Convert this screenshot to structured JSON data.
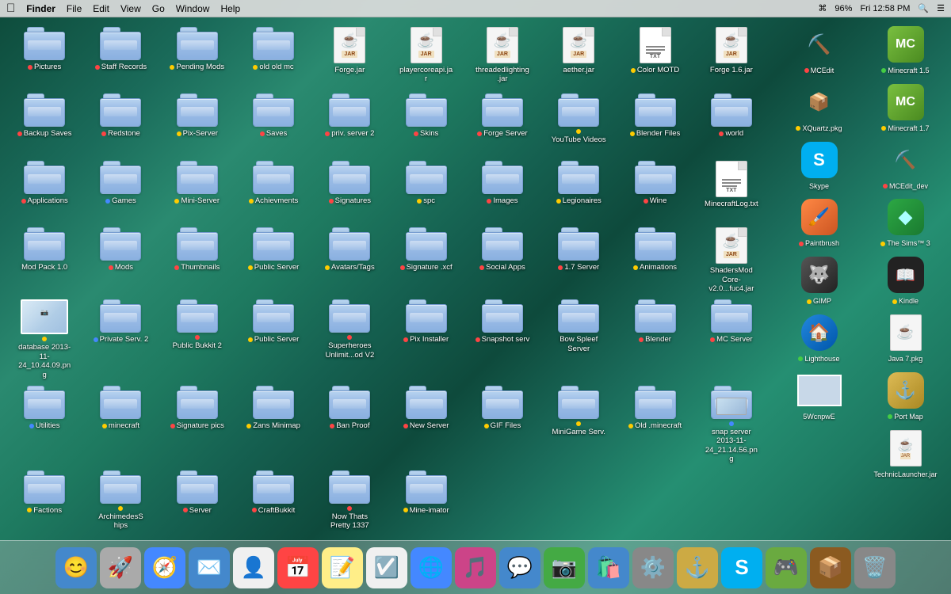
{
  "menubar": {
    "apple": "🍎",
    "items": [
      "Finder",
      "File",
      "Edit",
      "View",
      "Go",
      "Window",
      "Help"
    ],
    "right_items": [
      "96%",
      "Fri 12:58 PM"
    ],
    "battery": "96%",
    "time": "Fri 12:58 PM"
  },
  "desktop_items": [
    {
      "id": "pictures",
      "label": "Pictures",
      "dot": "red",
      "type": "folder",
      "row": 1,
      "col": 1
    },
    {
      "id": "staff-records",
      "label": "Staff Records",
      "dot": "red",
      "type": "folder",
      "row": 1,
      "col": 2
    },
    {
      "id": "pending-mods",
      "label": "Pending Mods",
      "dot": "yellow",
      "type": "folder",
      "row": 1,
      "col": 3
    },
    {
      "id": "old-old-mc",
      "label": "old old mc",
      "dot": "yellow",
      "type": "folder",
      "row": 1,
      "col": 4
    },
    {
      "id": "forge-jar",
      "label": "Forge.jar",
      "dot": "none",
      "type": "jar",
      "row": 1,
      "col": 5
    },
    {
      "id": "playercoreapi-jar",
      "label": "playercoreapi.jar",
      "dot": "none",
      "type": "jar",
      "row": 1,
      "col": 6
    },
    {
      "id": "threadedlighting-jar",
      "label": "threadedlighting.jar",
      "dot": "none",
      "type": "jar",
      "row": 1,
      "col": 7
    },
    {
      "id": "aether-jar",
      "label": "aether.jar",
      "dot": "none",
      "type": "jar",
      "row": 1,
      "col": 8
    },
    {
      "id": "color-motd",
      "label": "Color MOTD",
      "dot": "yellow",
      "type": "txt",
      "row": 1,
      "col": 9
    },
    {
      "id": "forge16-jar",
      "label": "Forge 1.6.jar",
      "dot": "none",
      "type": "jar",
      "row": 1,
      "col": 10
    },
    {
      "id": "backup-saves",
      "label": "Backup Saves",
      "dot": "red",
      "type": "folder",
      "row": 2,
      "col": 1
    },
    {
      "id": "redstone",
      "label": "Redstone",
      "dot": "red",
      "type": "folder",
      "row": 2,
      "col": 2
    },
    {
      "id": "pix-server",
      "label": "Pix-Server",
      "dot": "yellow",
      "type": "folder",
      "row": 2,
      "col": 3
    },
    {
      "id": "saves",
      "label": "Saves",
      "dot": "red",
      "type": "folder",
      "row": 2,
      "col": 4
    },
    {
      "id": "priv-server-2",
      "label": "priv. server 2",
      "dot": "red",
      "type": "folder",
      "row": 2,
      "col": 5
    },
    {
      "id": "skins",
      "label": "Skins",
      "dot": "red",
      "type": "folder",
      "row": 2,
      "col": 6
    },
    {
      "id": "forge-server",
      "label": "Forge Server",
      "dot": "red",
      "type": "folder",
      "row": 2,
      "col": 7
    },
    {
      "id": "youtube-videos",
      "label": "YouTube Videos",
      "dot": "yellow",
      "type": "folder",
      "row": 2,
      "col": 8
    },
    {
      "id": "blender-files",
      "label": "Blender Files",
      "dot": "yellow",
      "type": "folder",
      "row": 2,
      "col": 9
    },
    {
      "id": "world",
      "label": "world",
      "dot": "red",
      "type": "folder",
      "row": 2,
      "col": 10
    },
    {
      "id": "applications",
      "label": "Applications",
      "dot": "red",
      "type": "folder",
      "row": 3,
      "col": 1
    },
    {
      "id": "games",
      "label": "Games",
      "dot": "blue",
      "type": "folder",
      "row": 3,
      "col": 2
    },
    {
      "id": "mini-server",
      "label": "Mini-Server",
      "dot": "yellow",
      "type": "folder",
      "row": 3,
      "col": 3
    },
    {
      "id": "achievments",
      "label": "Achievments",
      "dot": "yellow",
      "type": "folder",
      "row": 3,
      "col": 4
    },
    {
      "id": "signatures",
      "label": "Signatures",
      "dot": "red",
      "type": "folder",
      "row": 3,
      "col": 5
    },
    {
      "id": "spc",
      "label": "spc",
      "dot": "yellow",
      "type": "folder",
      "row": 3,
      "col": 6
    },
    {
      "id": "images",
      "label": "Images",
      "dot": "red",
      "type": "folder",
      "row": 3,
      "col": 7
    },
    {
      "id": "legionaires",
      "label": "Legionaires",
      "dot": "yellow",
      "type": "folder",
      "row": 3,
      "col": 8
    },
    {
      "id": "wine",
      "label": "Wine",
      "dot": "red",
      "type": "folder",
      "row": 3,
      "col": 9
    },
    {
      "id": "minecraftlog-txt",
      "label": "MinecraftLog.txt",
      "dot": "none",
      "type": "txt",
      "row": 3,
      "col": 10
    },
    {
      "id": "mod-pack",
      "label": "Mod Pack 1.0",
      "dot": "none",
      "type": "folder",
      "row": 4,
      "col": 1
    },
    {
      "id": "mods",
      "label": "Mods",
      "dot": "red",
      "type": "folder",
      "row": 4,
      "col": 2
    },
    {
      "id": "thumbnails",
      "label": "Thumbnails",
      "dot": "red",
      "type": "folder",
      "row": 4,
      "col": 3
    },
    {
      "id": "public-server",
      "label": "Public Server",
      "dot": "yellow",
      "type": "folder",
      "row": 4,
      "col": 4
    },
    {
      "id": "avatars-tags",
      "label": "Avatars/Tags",
      "dot": "yellow",
      "type": "folder",
      "row": 4,
      "col": 5
    },
    {
      "id": "signature-xcf",
      "label": "Signature .xcf",
      "dot": "red",
      "type": "folder",
      "row": 4,
      "col": 6
    },
    {
      "id": "social-apps",
      "label": "Social Apps",
      "dot": "red",
      "type": "folder",
      "row": 4,
      "col": 7
    },
    {
      "id": "17-server",
      "label": "1.7 Server",
      "dot": "red",
      "type": "folder",
      "row": 4,
      "col": 8
    },
    {
      "id": "animations",
      "label": "Animations",
      "dot": "yellow",
      "type": "folder",
      "row": 4,
      "col": 9
    },
    {
      "id": "shadersmod-jar",
      "label": "ShadersMod Core-v2.0...fuc4.jar",
      "dot": "none",
      "type": "jar",
      "row": 4,
      "col": 10
    },
    {
      "id": "database-png",
      "label": "database 2013-11-24_10.44.09.png",
      "dot": "yellow",
      "type": "image",
      "row": 5,
      "col": 1
    },
    {
      "id": "private-serv",
      "label": "Private Serv. 2",
      "dot": "blue",
      "type": "folder",
      "row": 5,
      "col": 2
    },
    {
      "id": "public-bukkit",
      "label": "Public Bukkit 2",
      "dot": "red",
      "type": "folder",
      "row": 5,
      "col": 3
    },
    {
      "id": "public-server2",
      "label": "Public Server",
      "dot": "yellow",
      "type": "folder",
      "row": 5,
      "col": 4
    },
    {
      "id": "superheroes-unlim",
      "label": "Superheroes Unlimit...od V2",
      "dot": "red",
      "type": "folder",
      "row": 5,
      "col": 5
    },
    {
      "id": "pix-installer",
      "label": "Pix Installer",
      "dot": "red",
      "type": "folder",
      "row": 5,
      "col": 6
    },
    {
      "id": "snapshot-serv",
      "label": "Snapshot serv",
      "dot": "red",
      "type": "folder",
      "row": 5,
      "col": 7
    },
    {
      "id": "bow-spleef-server",
      "label": "Bow Spleef Server",
      "dot": "none",
      "type": "folder",
      "row": 5,
      "col": 8
    },
    {
      "id": "blender-app",
      "label": "Blender",
      "dot": "red",
      "type": "folder",
      "row": 5,
      "col": 9
    },
    {
      "id": "mc-server",
      "label": "MC Server",
      "dot": "red",
      "type": "folder",
      "row": 6,
      "col": 1
    },
    {
      "id": "utilities",
      "label": "Utilities",
      "dot": "blue",
      "type": "folder",
      "row": 6,
      "col": 2
    },
    {
      "id": "minecraft-folder",
      "label": "minecraft",
      "dot": "yellow",
      "type": "folder",
      "row": 6,
      "col": 3
    },
    {
      "id": "signature-pics",
      "label": "Signature pics",
      "dot": "red",
      "type": "folder",
      "row": 6,
      "col": 4
    },
    {
      "id": "zans-minimap",
      "label": "Zans Minimap",
      "dot": "yellow",
      "type": "folder",
      "row": 6,
      "col": 5
    },
    {
      "id": "ban-proof",
      "label": "Ban Proof",
      "dot": "red",
      "type": "folder",
      "row": 6,
      "col": 6
    },
    {
      "id": "new-server",
      "label": "New Server",
      "dot": "red",
      "type": "folder",
      "row": 6,
      "col": 7
    },
    {
      "id": "gif-files",
      "label": "GIF Files",
      "dot": "yellow",
      "type": "folder",
      "row": 6,
      "col": 8
    },
    {
      "id": "minigame-serv",
      "label": "MiniGame Serv.",
      "dot": "yellow",
      "type": "folder",
      "row": 6,
      "col": 9
    },
    {
      "id": "old-minecraft",
      "label": "Old .minecraft",
      "dot": "yellow",
      "type": "folder",
      "row": 7,
      "col": 1
    },
    {
      "id": "snap-server",
      "label": "snap server 2013-11-24_21.14.56.png",
      "dot": "blue",
      "type": "folder_img",
      "row": 7,
      "col": 2
    },
    {
      "id": "factions",
      "label": "Factions",
      "dot": "yellow",
      "type": "folder",
      "row": 7,
      "col": 3
    },
    {
      "id": "archimedes-ships",
      "label": "ArchimedesS hips",
      "dot": "yellow",
      "type": "folder",
      "row": 7,
      "col": 4
    },
    {
      "id": "server",
      "label": "Server",
      "dot": "red",
      "type": "folder",
      "row": 7,
      "col": 5
    },
    {
      "id": "craftbukkit",
      "label": "CraftBukkit",
      "dot": "red",
      "type": "folder",
      "row": 7,
      "col": 6
    },
    {
      "id": "now-thats-pretty",
      "label": "Now Thats Pretty 1337",
      "dot": "red",
      "type": "folder",
      "row": 7,
      "col": 7
    },
    {
      "id": "mine-imator",
      "label": "Mine-imator",
      "dot": "yellow",
      "type": "folder",
      "row": 7,
      "col": 8
    }
  ],
  "right_apps": [
    {
      "id": "mcedit",
      "label": "MCEdit",
      "dot": "red",
      "color": "#4a8a4a",
      "emoji": "⛏️"
    },
    {
      "id": "minecraft15",
      "label": "Minecraft 1.5",
      "dot": "green",
      "color": "#5a9a3a",
      "emoji": "🎮"
    },
    {
      "id": "xquartz-pkg",
      "label": "XQuartz.pkg",
      "dot": "yellow",
      "color": "#888",
      "emoji": "📦"
    },
    {
      "id": "minecraft17",
      "label": "Minecraft 1.7",
      "dot": "yellow",
      "color": "#6aaa40",
      "emoji": "🎮"
    },
    {
      "id": "skype",
      "label": "Skype",
      "dot": "none",
      "color": "#00aff0",
      "emoji": "S"
    },
    {
      "id": "mcedit-dev",
      "label": "MCEdit_dev",
      "dot": "red",
      "color": "#4a8a4a",
      "emoji": "⛏️"
    },
    {
      "id": "paintbrush",
      "label": "Paintbrush",
      "dot": "red",
      "color": "#cc6622",
      "emoji": "🖌️"
    },
    {
      "id": "sims3",
      "label": "The Sims™ 3",
      "dot": "yellow",
      "color": "#2ca844",
      "emoji": "💎"
    },
    {
      "id": "gimp",
      "label": "GIMP",
      "dot": "yellow",
      "color": "#333",
      "emoji": "🐺"
    },
    {
      "id": "kindle",
      "label": "Kindle",
      "dot": "yellow",
      "color": "#ff9900",
      "emoji": "📖"
    },
    {
      "id": "lighthouse",
      "label": "Lighthouse",
      "dot": "green",
      "color": "#1177cc",
      "emoji": "🏠"
    },
    {
      "id": "java7-pkg",
      "label": "Java 7.pkg",
      "dot": "none",
      "color": "#888",
      "emoji": "☕"
    },
    {
      "id": "5wcnpwe",
      "label": "5WcnpwE",
      "dot": "none",
      "color": "#888",
      "emoji": "🖼️"
    },
    {
      "id": "port-map",
      "label": "Port Map",
      "dot": "green",
      "color": "#ccaa44",
      "emoji": "⚓"
    },
    {
      "id": "technic-launcher",
      "label": "TechnicLauncher.jar",
      "dot": "none",
      "color": "#555",
      "emoji": "☕"
    }
  ],
  "dock_items": [
    {
      "id": "finder",
      "emoji": "😊",
      "color": "#4488cc",
      "label": "Finder"
    },
    {
      "id": "launchpad",
      "emoji": "🚀",
      "color": "#cccccc",
      "label": "Launchpad"
    },
    {
      "id": "safari",
      "emoji": "🧭",
      "color": "#4488ff",
      "label": "Safari"
    },
    {
      "id": "mail",
      "emoji": "✉️",
      "color": "#4488cc",
      "label": "Mail"
    },
    {
      "id": "contacts",
      "emoji": "👤",
      "color": "#f5f5f5",
      "label": "Contacts"
    },
    {
      "id": "calendar",
      "emoji": "📅",
      "color": "#ff4444",
      "label": "Calendar"
    },
    {
      "id": "notes",
      "emoji": "📝",
      "color": "#ffee88",
      "label": "Notes"
    },
    {
      "id": "reminders",
      "emoji": "☑️",
      "color": "#f5f5f5",
      "label": "Reminders"
    },
    {
      "id": "chrome",
      "emoji": "🌐",
      "color": "#4488ff",
      "label": "Chrome"
    },
    {
      "id": "itunes",
      "emoji": "🎵",
      "color": "#cc4488",
      "label": "iTunes"
    },
    {
      "id": "messages",
      "emoji": "💬",
      "color": "#4488cc",
      "label": "Messages"
    },
    {
      "id": "facetime",
      "emoji": "📷",
      "color": "#44aa44",
      "label": "FaceTime"
    },
    {
      "id": "appstore",
      "emoji": "🛍️",
      "color": "#4488cc",
      "label": "App Store"
    },
    {
      "id": "system-prefs",
      "emoji": "⚙️",
      "color": "#888888",
      "label": "System Preferences"
    },
    {
      "id": "dock-portmap",
      "emoji": "⚓",
      "color": "#ccaa44",
      "label": "Port Map"
    },
    {
      "id": "skype-dock",
      "emoji": "S",
      "color": "#00aff0",
      "label": "Skype"
    },
    {
      "id": "minecraft-dock",
      "emoji": "🎮",
      "color": "#6aaa40",
      "label": "Minecraft"
    },
    {
      "id": "chest",
      "emoji": "📦",
      "color": "#8b5a20",
      "label": "Chest"
    },
    {
      "id": "trash",
      "emoji": "🗑️",
      "color": "#888888",
      "label": "Trash"
    }
  ]
}
